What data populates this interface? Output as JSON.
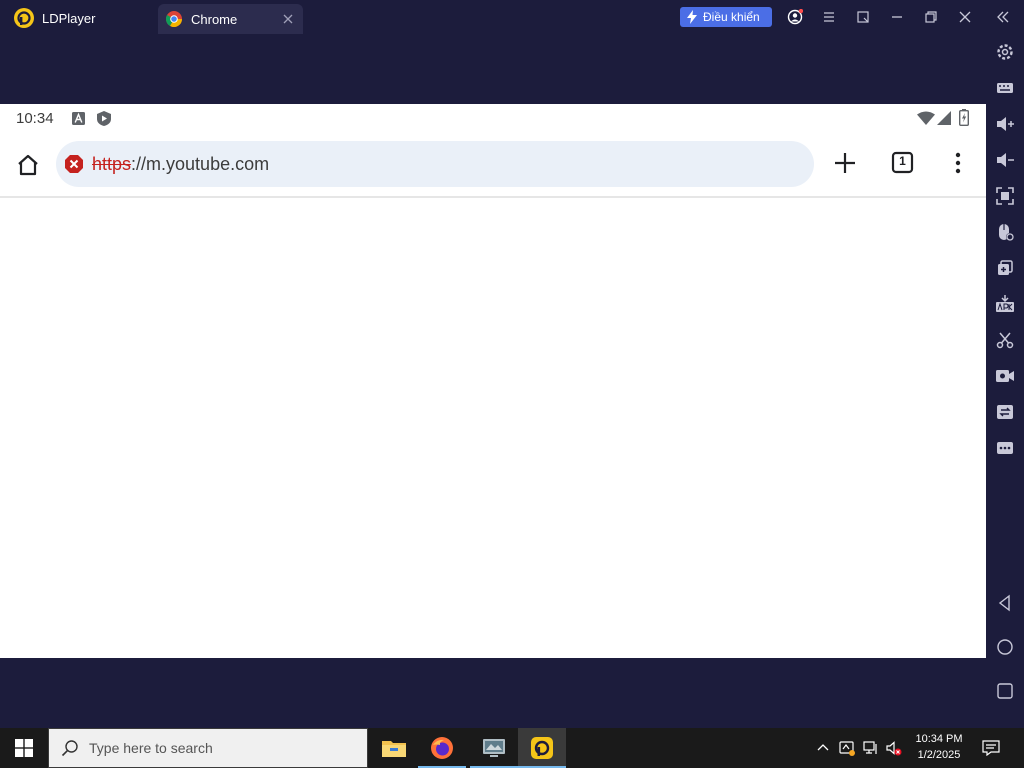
{
  "ld": {
    "app_title": "LDPlayer",
    "tab_label": "Chrome",
    "control_label": "Điều khiển"
  },
  "android": {
    "status_time": "10:34",
    "url_scheme": "https",
    "url_rest": "://m.youtube.com",
    "tab_count": "1"
  },
  "taskbar": {
    "search_placeholder": "Type here to search",
    "time": "10:34 PM",
    "date": "1/2/2025"
  },
  "icons": {
    "right_toolbar": [
      "gear-icon",
      "keyboard-icon",
      "volume-up-icon",
      "volume-down-icon",
      "fullscreen-icon",
      "mouse-lock-icon",
      "multi-instance-icon",
      "apk-install-icon",
      "scissors-icon",
      "record-icon",
      "sync-icon",
      "more-icon",
      "back-nav-icon",
      "home-nav-icon",
      "recents-nav-icon"
    ]
  },
  "colors": {
    "frame_bg": "#1c1c3c",
    "control_button": "#4b6ee6",
    "omnibox_bg": "#eaf0f8",
    "error_red": "#c5221f",
    "taskbar_bg": "#1a1a1a"
  }
}
